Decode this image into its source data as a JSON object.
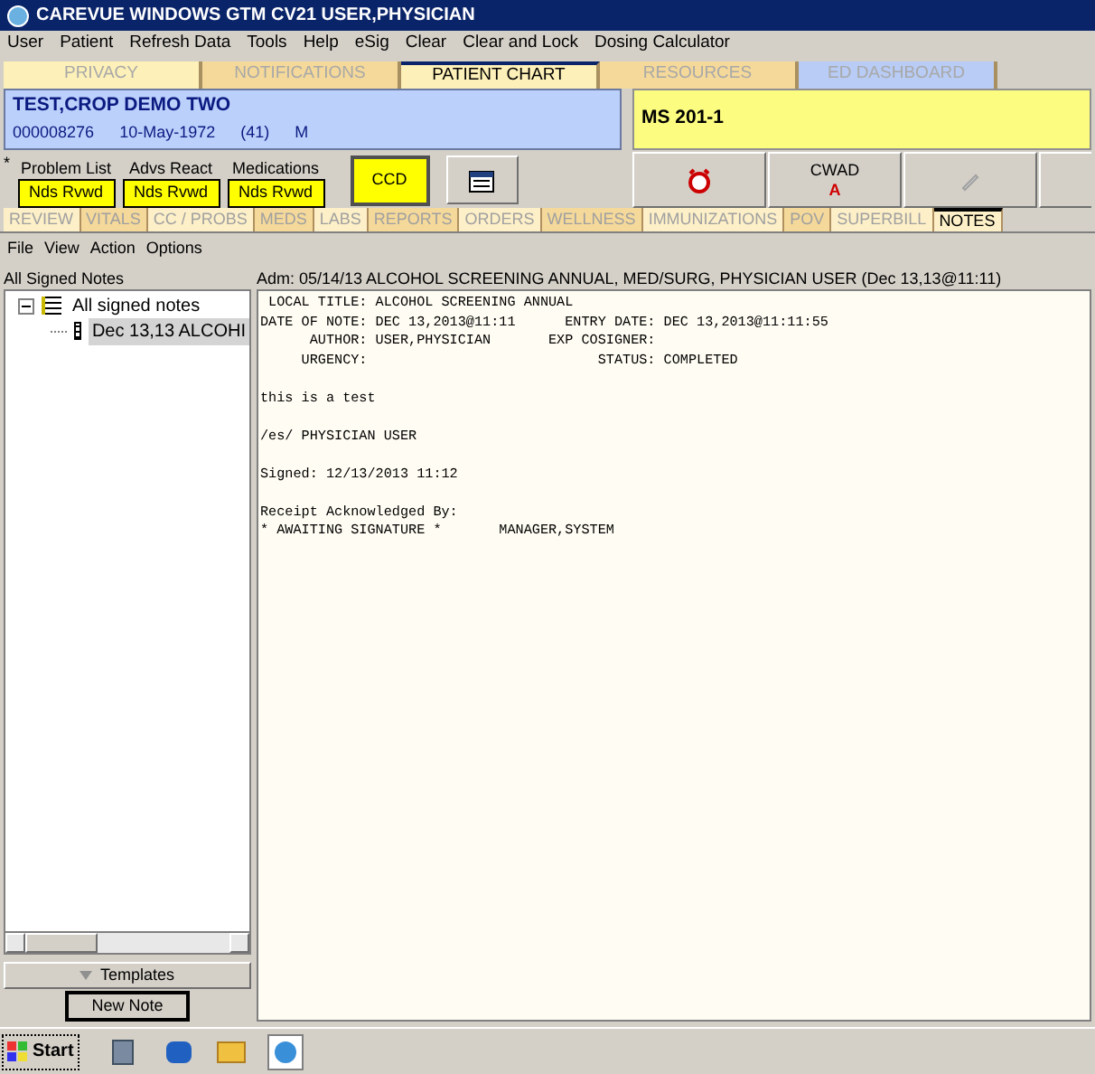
{
  "window": {
    "title": "CAREVUE WINDOWS GTM CV21 USER,PHYSICIAN"
  },
  "menu": [
    "User",
    "Patient",
    "Refresh Data",
    "Tools",
    "Help",
    "eSig",
    "Clear",
    "Clear and Lock",
    "Dosing Calculator"
  ],
  "top_tabs": [
    {
      "label": "PRIVACY",
      "selected": false,
      "color": "#fdf0b8"
    },
    {
      "label": "NOTIFICATIONS",
      "selected": false,
      "color": "#f5d99a"
    },
    {
      "label": "PATIENT CHART",
      "selected": true,
      "color": "#fdf0b8"
    },
    {
      "label": "RESOURCES",
      "selected": false,
      "color": "#f5d99a"
    },
    {
      "label": "ED DASHBOARD",
      "selected": false,
      "color": "#b8ccf5"
    }
  ],
  "patient": {
    "name": "TEST,CROP DEMO TWO",
    "id": "000008276",
    "dob": "10-May-1972",
    "age": "(41)",
    "sex": "M"
  },
  "location": "MS  201-1",
  "star": "*",
  "alerts": [
    {
      "label": "Problem List",
      "value": "Nds Rvwd"
    },
    {
      "label": "Advs React",
      "value": "Nds Rvwd"
    },
    {
      "label": "Medications",
      "value": "Nds Rvwd"
    }
  ],
  "ccd": "CCD",
  "cwad": {
    "label": "CWAD",
    "code": "A"
  },
  "module_tabs": [
    {
      "label": "REVIEW",
      "selected": false,
      "color": "#fdf0c8"
    },
    {
      "label": "VITALS",
      "selected": false,
      "color": "#f5d99a"
    },
    {
      "label": "CC / PROBS",
      "selected": false,
      "color": "#fdf0c8"
    },
    {
      "label": "MEDS",
      "selected": false,
      "color": "#f5d99a"
    },
    {
      "label": "LABS",
      "selected": false,
      "color": "#fdf0c8"
    },
    {
      "label": "REPORTS",
      "selected": false,
      "color": "#f5d99a"
    },
    {
      "label": "ORDERS",
      "selected": false,
      "color": "#fdf0c8"
    },
    {
      "label": "WELLNESS",
      "selected": false,
      "color": "#f5d99a"
    },
    {
      "label": "IMMUNIZATIONS",
      "selected": false,
      "color": "#fdf0c8"
    },
    {
      "label": "POV",
      "selected": false,
      "color": "#f5d99a"
    },
    {
      "label": "SUPERBILL",
      "selected": false,
      "color": "#fdf0c8"
    },
    {
      "label": "NOTES",
      "selected": true,
      "color": "#fdf0c8"
    }
  ],
  "sub_menu": [
    "File",
    "View",
    "Action",
    "Options"
  ],
  "tree": {
    "title": "All Signed Notes",
    "items": [
      {
        "label": "All signed notes",
        "expanded": true,
        "children": [
          {
            "label": "Dec 13,13 ALCOHI",
            "selected": true
          }
        ]
      }
    ]
  },
  "note": {
    "header": "Adm: 05/14/13  ALCOHOL SCREENING ANNUAL, MED/SURG, PHYSICIAN USER  (Dec 13,13@11:11)",
    "paragraphs": [
      [
        " LOCAL TITLE: ALCOHOL SCREENING ANNUAL",
        "DATE OF NOTE: DEC 13,2013@11:11      ENTRY DATE: DEC 13,2013@11:11:55",
        "      AUTHOR: USER,PHYSICIAN       EXP COSIGNER:",
        "     URGENCY:                            STATUS: COMPLETED"
      ],
      [
        "this is a test"
      ],
      [
        "/es/ PHYSICIAN USER"
      ],
      [
        "Signed: 12/13/2013 11:12"
      ],
      [
        "Receipt Acknowledged By:",
        "* AWAITING SIGNATURE *       MANAGER,SYSTEM"
      ]
    ]
  },
  "templates_button": "Templates",
  "new_note_button": "New Note",
  "taskbar": {
    "start": "Start"
  }
}
